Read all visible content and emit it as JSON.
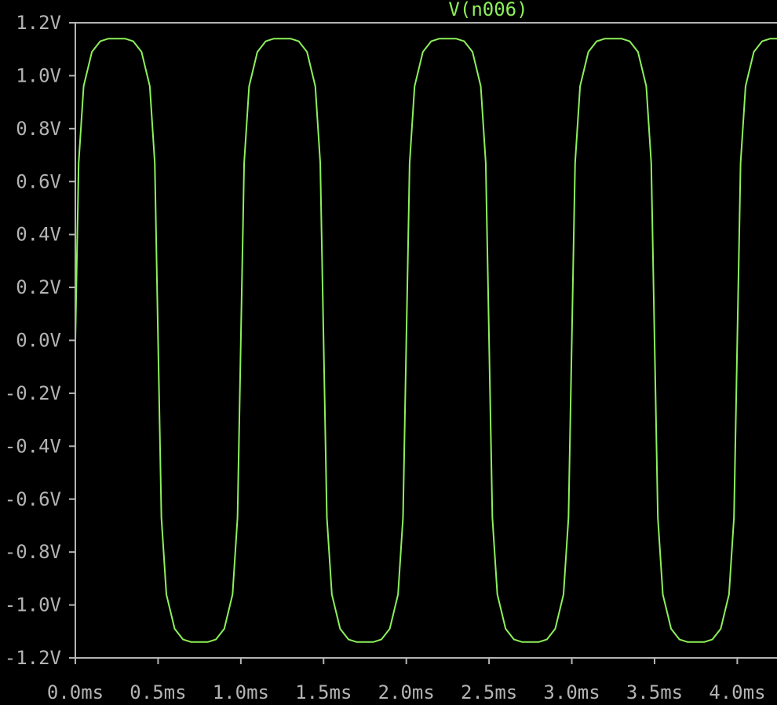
{
  "chart_data": {
    "type": "line",
    "title": "V(n006)",
    "xlim": [
      0,
      4.24
    ],
    "ylim": [
      -1.2,
      1.2
    ],
    "x_ticks": [
      "0.0ms",
      "0.5ms",
      "1.0ms",
      "1.5ms",
      "2.0ms",
      "2.5ms",
      "3.0ms",
      "3.5ms",
      "4.0ms"
    ],
    "y_ticks": [
      "1.2V",
      "1.0V",
      "0.8V",
      "0.6V",
      "0.4V",
      "0.2V",
      "0.0V",
      "-0.2V",
      "-0.4V",
      "-0.6V",
      "-0.8V",
      "-1.0V",
      "-1.2V"
    ],
    "series": [
      {
        "name": "V(n006)",
        "color": "#8cf05a",
        "x_unit": "ms",
        "y_unit": "V",
        "x": [
          0.0,
          0.02,
          0.05,
          0.1,
          0.15,
          0.2,
          0.25,
          0.3,
          0.35,
          0.4,
          0.45,
          0.48,
          0.5,
          0.52,
          0.55,
          0.6,
          0.65,
          0.7,
          0.75,
          0.8,
          0.85,
          0.9,
          0.95,
          0.98,
          1.0,
          1.02,
          1.05,
          1.1,
          1.15,
          1.2,
          1.25,
          1.3,
          1.35,
          1.4,
          1.45,
          1.48,
          1.5,
          1.52,
          1.55,
          1.6,
          1.65,
          1.7,
          1.75,
          1.8,
          1.85,
          1.9,
          1.95,
          1.98,
          2.0,
          2.02,
          2.05,
          2.1,
          2.15,
          2.2,
          2.25,
          2.3,
          2.35,
          2.4,
          2.45,
          2.48,
          2.5,
          2.52,
          2.55,
          2.6,
          2.65,
          2.7,
          2.75,
          2.8,
          2.85,
          2.9,
          2.95,
          2.98,
          3.0,
          3.02,
          3.05,
          3.1,
          3.15,
          3.2,
          3.25,
          3.3,
          3.35,
          3.4,
          3.45,
          3.48,
          3.5,
          3.52,
          3.55,
          3.6,
          3.65,
          3.7,
          3.75,
          3.8,
          3.85,
          3.9,
          3.95,
          3.98,
          4.0,
          4.02,
          4.05,
          4.1,
          4.15,
          4.2,
          4.24
        ],
        "y": [
          0.0,
          0.67,
          0.96,
          1.09,
          1.13,
          1.14,
          1.14,
          1.14,
          1.13,
          1.09,
          0.96,
          0.67,
          0.0,
          -0.67,
          -0.96,
          -1.09,
          -1.13,
          -1.14,
          -1.14,
          -1.14,
          -1.13,
          -1.09,
          -0.96,
          -0.67,
          0.0,
          0.67,
          0.96,
          1.09,
          1.13,
          1.14,
          1.14,
          1.14,
          1.13,
          1.09,
          0.96,
          0.67,
          0.0,
          -0.67,
          -0.96,
          -1.09,
          -1.13,
          -1.14,
          -1.14,
          -1.14,
          -1.13,
          -1.09,
          -0.96,
          -0.67,
          0.0,
          0.67,
          0.96,
          1.09,
          1.13,
          1.14,
          1.14,
          1.14,
          1.13,
          1.09,
          0.96,
          0.67,
          0.0,
          -0.67,
          -0.96,
          -1.09,
          -1.13,
          -1.14,
          -1.14,
          -1.14,
          -1.13,
          -1.09,
          -0.96,
          -0.67,
          0.0,
          0.67,
          0.96,
          1.09,
          1.13,
          1.14,
          1.14,
          1.14,
          1.13,
          1.09,
          0.96,
          0.67,
          0.0,
          -0.67,
          -0.96,
          -1.09,
          -1.13,
          -1.14,
          -1.14,
          -1.14,
          -1.13,
          -1.09,
          -0.96,
          -0.67,
          0.0,
          0.67,
          0.96,
          1.09,
          1.13,
          1.14,
          1.14
        ]
      }
    ],
    "grid": false,
    "background": "#000000",
    "axis_color": "#b4b4b4",
    "title_color": "#8cf05a"
  }
}
